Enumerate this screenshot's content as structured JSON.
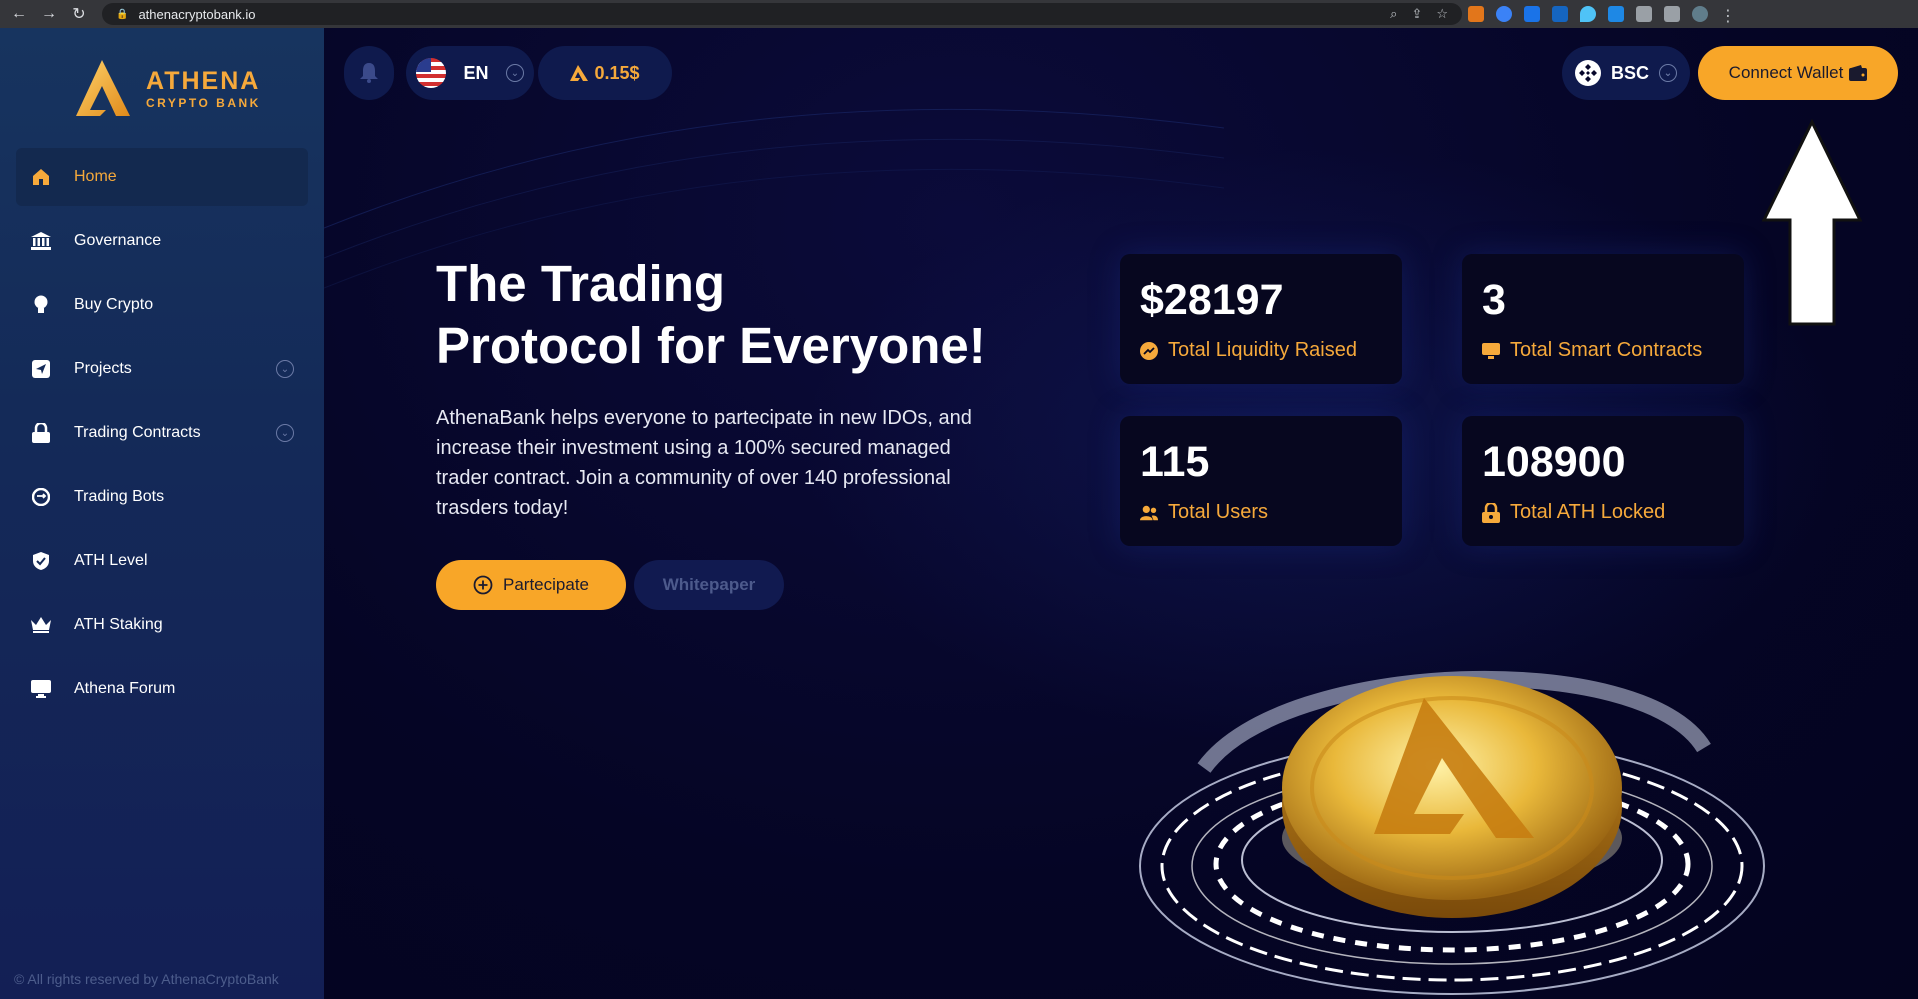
{
  "browser": {
    "url": "athenacryptobank.io"
  },
  "brand": {
    "name": "ATHENA",
    "tagline": "CRYPTO BANK",
    "accent": "#f6a93b"
  },
  "sidebar": {
    "items": [
      {
        "label": "Home",
        "icon": "home-icon",
        "active": true
      },
      {
        "label": "Governance",
        "icon": "bank-icon"
      },
      {
        "label": "Buy Crypto",
        "icon": "lightbulb-icon"
      },
      {
        "label": "Projects",
        "icon": "send-icon",
        "expandable": true
      },
      {
        "label": "Trading Contracts",
        "icon": "lock-icon",
        "expandable": true
      },
      {
        "label": "Trading Bots",
        "icon": "refresh-icon"
      },
      {
        "label": "ATH Level",
        "icon": "shield-icon"
      },
      {
        "label": "ATH Staking",
        "icon": "crown-icon"
      },
      {
        "label": "Athena Forum",
        "icon": "monitor-icon"
      }
    ],
    "copyright": "© All rights reserved by AthenaCryptoBank"
  },
  "topbar": {
    "language": "EN",
    "price": "0.15$",
    "network": "BSC",
    "connect_label": "Connect Wallet"
  },
  "hero": {
    "title_line1": "The Trading",
    "title_line2": "Protocol for Everyone!",
    "description": "AthenaBank helps everyone to partecipate in new IDOs, and increase their investment using a 100% secured managed trader contract. Join a community of over 140 professional trasders today!",
    "participate_label": "Partecipate",
    "whitepaper_label": "Whitepaper"
  },
  "stats": [
    {
      "value": "$28197",
      "label": "Total Liquidity Raised",
      "icon": "chart-icon"
    },
    {
      "value": "3",
      "label": "Total Smart Contracts",
      "icon": "contract-icon"
    },
    {
      "value": "115",
      "label": "Total Users",
      "icon": "users-icon"
    },
    {
      "value": "108900",
      "label": "Total ATH Locked",
      "icon": "lock-icon"
    }
  ]
}
